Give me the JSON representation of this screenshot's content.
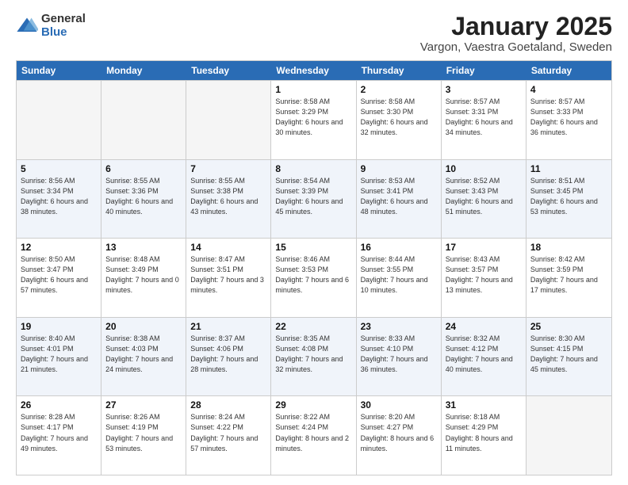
{
  "logo": {
    "general": "General",
    "blue": "Blue"
  },
  "title": "January 2025",
  "subtitle": "Vargon, Vaestra Goetaland, Sweden",
  "days": [
    "Sunday",
    "Monday",
    "Tuesday",
    "Wednesday",
    "Thursday",
    "Friday",
    "Saturday"
  ],
  "rows": [
    [
      {
        "day": "",
        "empty": true
      },
      {
        "day": "",
        "empty": true
      },
      {
        "day": "",
        "empty": true
      },
      {
        "day": "1",
        "sunrise": "8:58 AM",
        "sunset": "3:29 PM",
        "daylight": "6 hours and 30 minutes."
      },
      {
        "day": "2",
        "sunrise": "8:58 AM",
        "sunset": "3:30 PM",
        "daylight": "6 hours and 32 minutes."
      },
      {
        "day": "3",
        "sunrise": "8:57 AM",
        "sunset": "3:31 PM",
        "daylight": "6 hours and 34 minutes."
      },
      {
        "day": "4",
        "sunrise": "8:57 AM",
        "sunset": "3:33 PM",
        "daylight": "6 hours and 36 minutes."
      }
    ],
    [
      {
        "day": "5",
        "sunrise": "8:56 AM",
        "sunset": "3:34 PM",
        "daylight": "6 hours and 38 minutes."
      },
      {
        "day": "6",
        "sunrise": "8:55 AM",
        "sunset": "3:36 PM",
        "daylight": "6 hours and 40 minutes."
      },
      {
        "day": "7",
        "sunrise": "8:55 AM",
        "sunset": "3:38 PM",
        "daylight": "6 hours and 43 minutes."
      },
      {
        "day": "8",
        "sunrise": "8:54 AM",
        "sunset": "3:39 PM",
        "daylight": "6 hours and 45 minutes."
      },
      {
        "day": "9",
        "sunrise": "8:53 AM",
        "sunset": "3:41 PM",
        "daylight": "6 hours and 48 minutes."
      },
      {
        "day": "10",
        "sunrise": "8:52 AM",
        "sunset": "3:43 PM",
        "daylight": "6 hours and 51 minutes."
      },
      {
        "day": "11",
        "sunrise": "8:51 AM",
        "sunset": "3:45 PM",
        "daylight": "6 hours and 53 minutes."
      }
    ],
    [
      {
        "day": "12",
        "sunrise": "8:50 AM",
        "sunset": "3:47 PM",
        "daylight": "6 hours and 57 minutes."
      },
      {
        "day": "13",
        "sunrise": "8:48 AM",
        "sunset": "3:49 PM",
        "daylight": "7 hours and 0 minutes."
      },
      {
        "day": "14",
        "sunrise": "8:47 AM",
        "sunset": "3:51 PM",
        "daylight": "7 hours and 3 minutes."
      },
      {
        "day": "15",
        "sunrise": "8:46 AM",
        "sunset": "3:53 PM",
        "daylight": "7 hours and 6 minutes."
      },
      {
        "day": "16",
        "sunrise": "8:44 AM",
        "sunset": "3:55 PM",
        "daylight": "7 hours and 10 minutes."
      },
      {
        "day": "17",
        "sunrise": "8:43 AM",
        "sunset": "3:57 PM",
        "daylight": "7 hours and 13 minutes."
      },
      {
        "day": "18",
        "sunrise": "8:42 AM",
        "sunset": "3:59 PM",
        "daylight": "7 hours and 17 minutes."
      }
    ],
    [
      {
        "day": "19",
        "sunrise": "8:40 AM",
        "sunset": "4:01 PM",
        "daylight": "7 hours and 21 minutes."
      },
      {
        "day": "20",
        "sunrise": "8:38 AM",
        "sunset": "4:03 PM",
        "daylight": "7 hours and 24 minutes."
      },
      {
        "day": "21",
        "sunrise": "8:37 AM",
        "sunset": "4:06 PM",
        "daylight": "7 hours and 28 minutes."
      },
      {
        "day": "22",
        "sunrise": "8:35 AM",
        "sunset": "4:08 PM",
        "daylight": "7 hours and 32 minutes."
      },
      {
        "day": "23",
        "sunrise": "8:33 AM",
        "sunset": "4:10 PM",
        "daylight": "7 hours and 36 minutes."
      },
      {
        "day": "24",
        "sunrise": "8:32 AM",
        "sunset": "4:12 PM",
        "daylight": "7 hours and 40 minutes."
      },
      {
        "day": "25",
        "sunrise": "8:30 AM",
        "sunset": "4:15 PM",
        "daylight": "7 hours and 45 minutes."
      }
    ],
    [
      {
        "day": "26",
        "sunrise": "8:28 AM",
        "sunset": "4:17 PM",
        "daylight": "7 hours and 49 minutes."
      },
      {
        "day": "27",
        "sunrise": "8:26 AM",
        "sunset": "4:19 PM",
        "daylight": "7 hours and 53 minutes."
      },
      {
        "day": "28",
        "sunrise": "8:24 AM",
        "sunset": "4:22 PM",
        "daylight": "7 hours and 57 minutes."
      },
      {
        "day": "29",
        "sunrise": "8:22 AM",
        "sunset": "4:24 PM",
        "daylight": "8 hours and 2 minutes."
      },
      {
        "day": "30",
        "sunrise": "8:20 AM",
        "sunset": "4:27 PM",
        "daylight": "8 hours and 6 minutes."
      },
      {
        "day": "31",
        "sunrise": "8:18 AM",
        "sunset": "4:29 PM",
        "daylight": "8 hours and 11 minutes."
      },
      {
        "day": "",
        "empty": true
      }
    ]
  ]
}
